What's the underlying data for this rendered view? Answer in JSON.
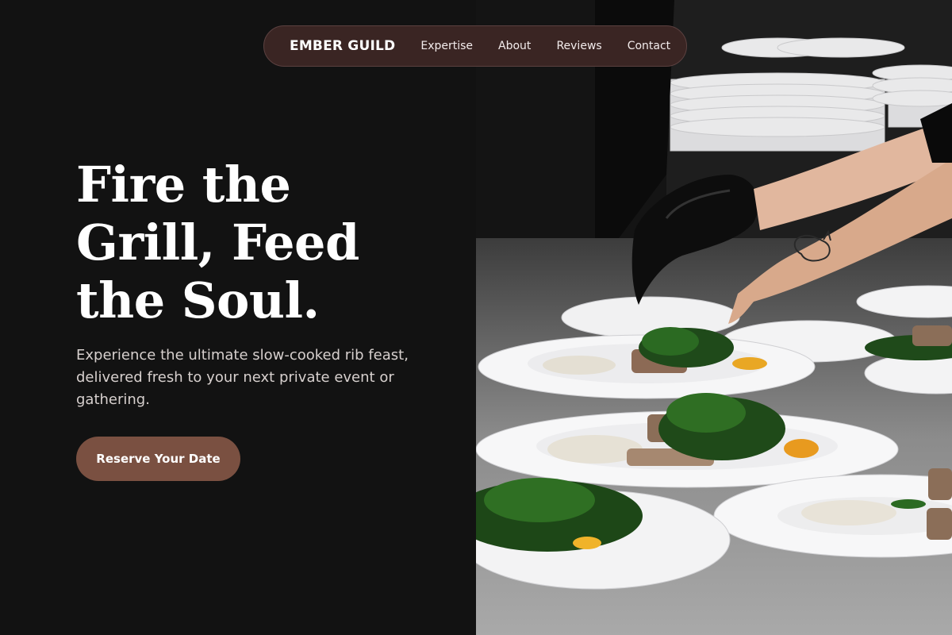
{
  "nav": {
    "brand": "EMBER GUILD",
    "links": [
      "Expertise",
      "About",
      "Reviews",
      "Contact"
    ]
  },
  "hero": {
    "title": "Fire the Grill, Feed the Soul.",
    "subtitle": "Experience the ultimate slow-cooked rib feast, delivered fresh to your next private event or gathering.",
    "cta": "Reserve Your Date"
  },
  "colors": {
    "background": "#121212",
    "nav_background": "#3a2523",
    "accent": "#7a5041",
    "text": "#ffffff"
  }
}
